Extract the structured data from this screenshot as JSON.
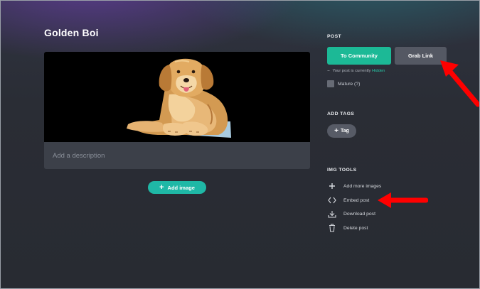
{
  "post": {
    "title": "Golden Boi",
    "description_placeholder": "Add a description",
    "add_image_label": "Add image"
  },
  "sidebar": {
    "post_heading": "POST",
    "to_community_label": "To Community",
    "grab_link_label": "Grab Link",
    "visibility_prefix": "Your post is currently",
    "visibility_status": "Hidden",
    "mature_label": "Mature (?)",
    "add_tags_heading": "ADD TAGS",
    "tag_button_label": "Tag",
    "img_tools_heading": "IMG TOOLS",
    "tools": [
      {
        "label": "Add more images",
        "icon": "plus-icon"
      },
      {
        "label": "Embed post",
        "icon": "code-brackets-icon"
      },
      {
        "label": "Download post",
        "icon": "download-icon"
      },
      {
        "label": "Delete post",
        "icon": "trash-icon"
      }
    ]
  },
  "colors": {
    "accent_green": "#1cb996",
    "accent_teal": "#1fb8a6",
    "annotation_red": "#ff0000",
    "background": "#2b2e36"
  }
}
